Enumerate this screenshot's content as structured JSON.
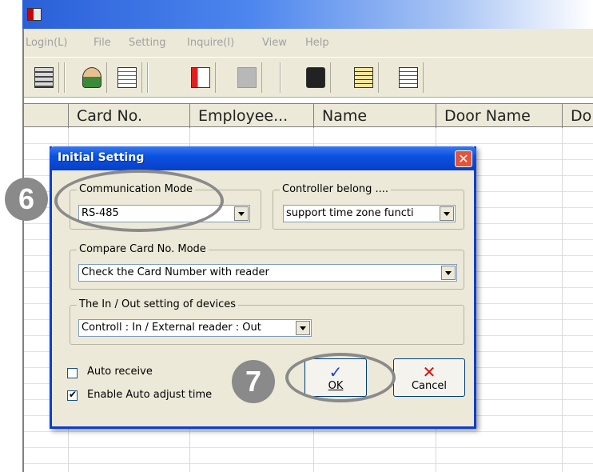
{
  "app": {
    "menu": [
      "Login(L)",
      "File",
      "Setting",
      "Inquire(I)",
      "View",
      "Help"
    ],
    "toolbar_icons": [
      "calculator-icon",
      "user-edit-icon",
      "document-icon",
      "import-icon",
      "disabled-export-icon",
      "monitor-icon",
      "clipboard-icon",
      "report-icon"
    ]
  },
  "grid": {
    "columns": [
      "Card No.",
      "Employee...",
      "Name",
      "Door Name",
      "Do"
    ]
  },
  "dialog": {
    "title": "Initial Setting",
    "close_glyph": "✕",
    "communication_mode": {
      "label": "Communication Mode",
      "value": "RS-485"
    },
    "controller_belong": {
      "label": "Controller belong ....",
      "value": "support time zone functi"
    },
    "compare_card": {
      "label": "Compare Card No.  Mode",
      "value": "Check the Card Number with reader"
    },
    "inout": {
      "label": "The In / Out setting of devices",
      "value": "Controll : In / External reader : Out"
    },
    "auto_receive": {
      "label": "Auto receive",
      "checked": false
    },
    "auto_adjust": {
      "label": "Enable Auto adjust time",
      "checked": true,
      "mark": "✔"
    },
    "ok": {
      "glyph": "✓",
      "label": "OK"
    },
    "cancel": {
      "glyph": "✕",
      "label": "Cancel"
    }
  },
  "annotations": {
    "step6": "6",
    "step7": "7"
  },
  "colors": {
    "title_blue": "#0a52e0",
    "annotation_gray": "#8a8a8a",
    "ok_check": "#1f3fd0",
    "cancel_x": "#d01010"
  }
}
